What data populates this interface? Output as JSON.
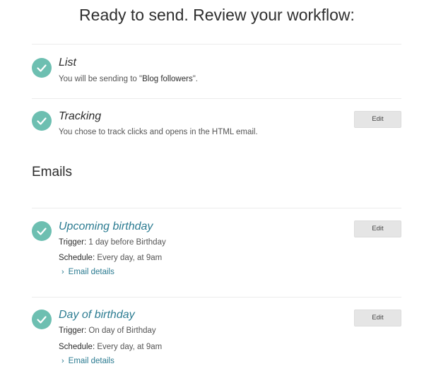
{
  "page": {
    "title": "Ready to send. Review your workflow:"
  },
  "list_step": {
    "title": "List",
    "desc_prefix": "You will be sending to \"",
    "desc_value": "Blog followers",
    "desc_suffix": "\"."
  },
  "tracking_step": {
    "title": "Tracking",
    "desc": "You chose to track clicks and opens in the HTML email.",
    "edit_label": "Edit"
  },
  "emails_section": {
    "heading": "Emails"
  },
  "emails": [
    {
      "title": "Upcoming birthday",
      "trigger_label": "Trigger:",
      "trigger_value": "1 day before Birthday",
      "schedule_label": "Schedule:",
      "schedule_value": "Every day, at 9am",
      "details_label": "Email details",
      "edit_label": "Edit"
    },
    {
      "title": "Day of birthday",
      "trigger_label": "Trigger:",
      "trigger_value": "On day of Birthday",
      "schedule_label": "Schedule:",
      "schedule_value": "Every day, at 9am",
      "details_label": "Email details",
      "edit_label": "Edit"
    }
  ],
  "icons": {
    "step_complete": "checkmark-circle-icon",
    "details_toggle": "chevron-right-icon"
  },
  "colors": {
    "check_green": "#6dbfb1",
    "link_teal": "#2b7b91",
    "button_gray": "#e5e5e5"
  }
}
